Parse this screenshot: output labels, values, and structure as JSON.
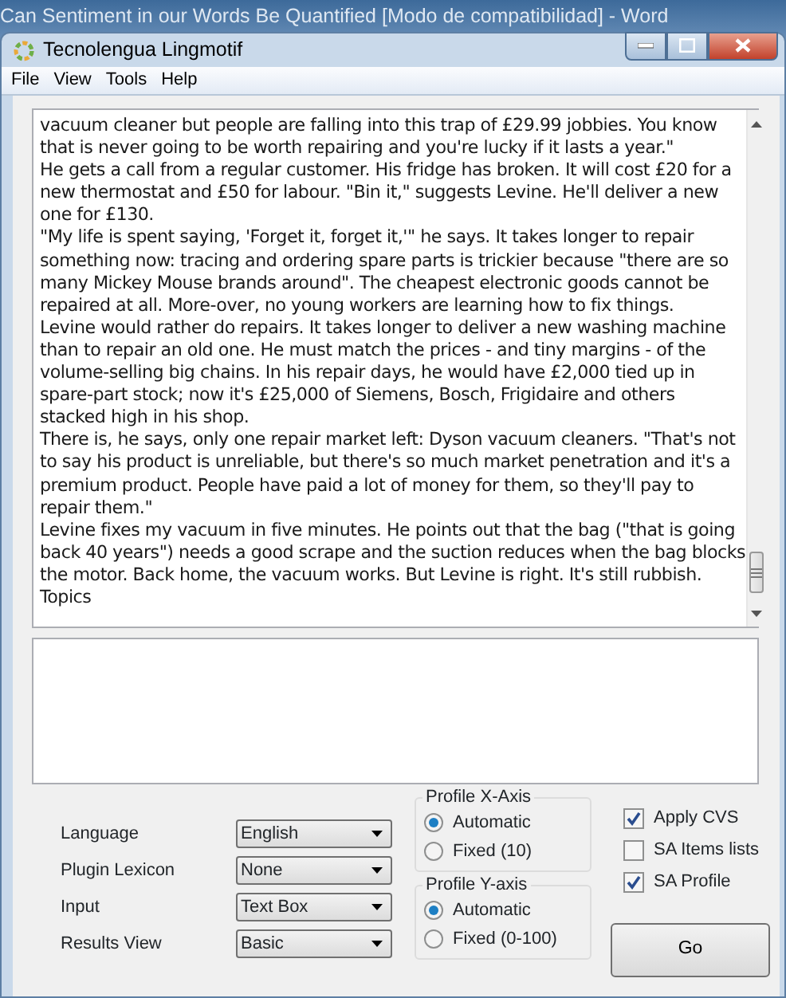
{
  "background_title": "Can Sentiment in our Words Be Quantified [Modo de compatibilidad]  -  Word",
  "window": {
    "title": "Tecnolengua Lingmotif"
  },
  "menu": [
    "File",
    "View",
    "Tools",
    "Help"
  ],
  "text_box": {
    "paragraphs": [
      [
        "vacuum cleaner but people are falling into this trap of £29.99 jobbies. You know",
        "that is never going to be worth repairing and you're lucky if it lasts a year.\""
      ],
      [
        "He gets a call from a regular customer. His fridge has broken. It will cost £20 for a",
        "new thermostat and £50 for labour. \"Bin it,\" suggests Levine. He'll deliver a new",
        "one for £130."
      ],
      [
        "\"My life is spent saying, 'Forget it, forget it,'\" he says. It takes longer to repair",
        "something now: tracing and ordering spare parts is trickier because \"there are so",
        "many Mickey Mouse brands around\". The cheapest electronic goods cannot be",
        "repaired at all. More-over, no young workers are learning how to fix things."
      ],
      [
        "Levine would rather do repairs. It takes longer to deliver a new washing machine",
        "than to repair an old one. He must match the prices - and tiny margins - of the",
        "volume-selling big chains. In his repair days, he would have £2,000 tied up in",
        "spare-part stock; now it's £25,000 of Siemens, Bosch, Frigidaire and others",
        "stacked high in his shop."
      ],
      [
        "There is, he says, only one repair market left: Dyson vacuum cleaners. \"That's not",
        "to say his product is unreliable, but there's so much market penetration and it's a",
        "premium product. People have paid a lot of money for them, so they'll pay to",
        "repair them.\""
      ],
      [
        "Levine fixes my vacuum in five minutes. He points out that the bag (\"that is going",
        "back 40 years\") needs a good scrape and the suction reduces when the bag blocks",
        "the motor. Back home, the vacuum works. But Levine is right. It's still rubbish."
      ],
      [
        "Topics"
      ]
    ]
  },
  "settings": [
    {
      "label": "Language",
      "value": "English"
    },
    {
      "label": "Plugin Lexicon",
      "value": "None"
    },
    {
      "label": "Input",
      "value": "Text Box"
    },
    {
      "label": "Results View",
      "value": "Basic"
    }
  ],
  "profile_groups": [
    {
      "title": "Profile X-Axis",
      "options": [
        {
          "label": "Automatic",
          "selected": true
        },
        {
          "label": "Fixed (10)",
          "selected": false
        }
      ]
    },
    {
      "title": "Profile Y-axis",
      "options": [
        {
          "label": "Automatic",
          "selected": true
        },
        {
          "label": "Fixed (0-100)",
          "selected": false
        }
      ]
    }
  ],
  "checkboxes": [
    {
      "label": "Apply CVS",
      "checked": true
    },
    {
      "label": "SA Items lists",
      "checked": false
    },
    {
      "label": "SA Profile",
      "checked": true
    }
  ],
  "go_button": "Go"
}
